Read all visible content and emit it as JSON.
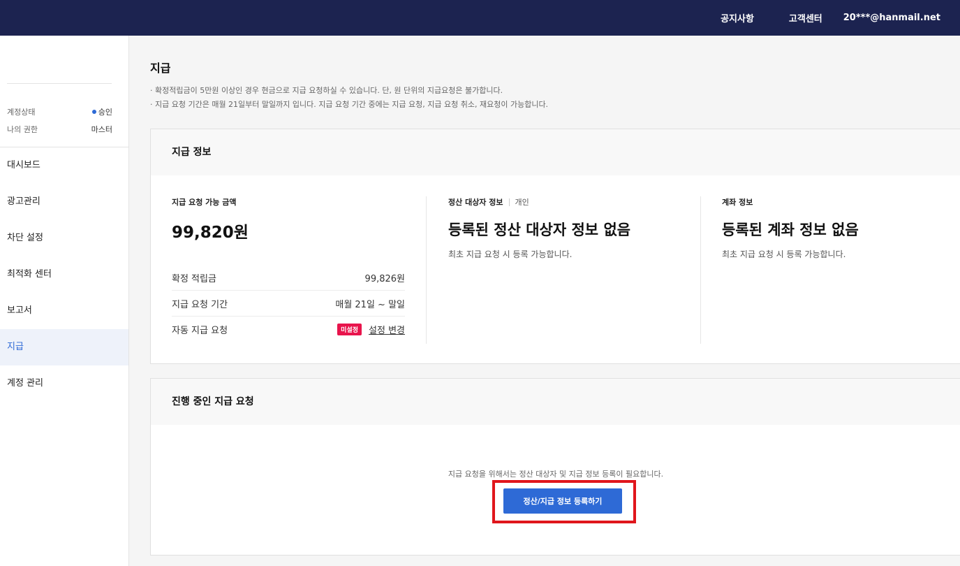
{
  "header": {
    "notice": "공지사항",
    "support": "고객센터",
    "user_email": "20***@hanmail.net"
  },
  "sidebar": {
    "status_label": "계정상태",
    "status_value": "승인",
    "role_label": "나의 권한",
    "role_value": "마스터",
    "menu": [
      {
        "label": "대시보드"
      },
      {
        "label": "광고관리"
      },
      {
        "label": "차단 설정"
      },
      {
        "label": "최적화 센터"
      },
      {
        "label": "보고서"
      },
      {
        "label": "지급"
      },
      {
        "label": "계정 관리"
      }
    ]
  },
  "page": {
    "title": "지급",
    "notices": [
      "· 확정적립금이 5만원 이상인 경우 현금으로 지급 요청하실 수 있습니다. 단, 원 단위의 지급요청은 불가합니다.",
      "· 지급 요청 기간은 매월 21일부터 말일까지 입니다. 지급 요청 기간 중에는 지급 요청, 지급 요청 취소, 재요청이 가능합니다."
    ]
  },
  "payment_info": {
    "title": "지급 정보",
    "available_label": "지급 요청 가능 금액",
    "available_amount": "99,820원",
    "rows": [
      {
        "label": "확정 적립금",
        "value": "99,826원"
      },
      {
        "label": "지급 요청 기간",
        "value": "매월 21일 ~ 말일"
      },
      {
        "label": "자동 지급 요청",
        "badge": "미설정",
        "link": "설정 변경"
      }
    ],
    "settlement_label": "정산 대상자 정보",
    "settlement_type": "개인",
    "settlement_empty": "등록된 정산 대상자 정보 없음",
    "settlement_sub": "최초 지급 요청 시 등록 가능합니다.",
    "account_label": "계좌 정보",
    "account_empty": "등록된 계좌 정보 없음",
    "account_sub": "최초 지급 요청 시 등록 가능합니다."
  },
  "pending": {
    "title": "진행 중인 지급 요청",
    "message": "지급 요청을 위해서는 정산 대상자 및 지급 정보 등록이 필요합니다.",
    "button": "정산/지급 정보 등록하기"
  },
  "colors": {
    "header_bg": "#1c2350",
    "accent": "#2e6ad6",
    "badge": "#e8144c",
    "highlight": "#e0161c"
  }
}
